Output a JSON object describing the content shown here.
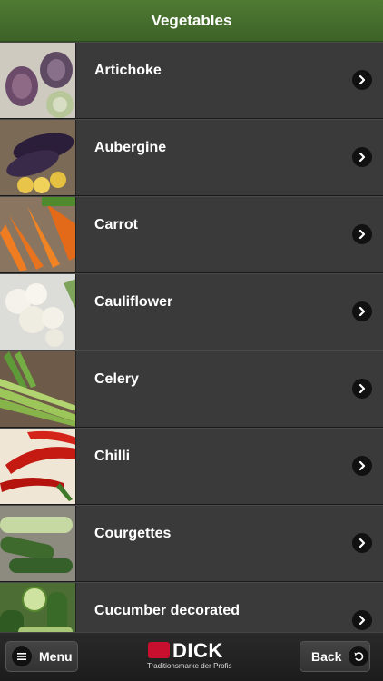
{
  "header": {
    "title": "Vegetables"
  },
  "items": [
    {
      "label": "Artichoke",
      "icon": "chevron-right-icon"
    },
    {
      "label": "Aubergine",
      "icon": "chevron-right-icon"
    },
    {
      "label": "Carrot",
      "icon": "chevron-right-icon"
    },
    {
      "label": "Cauliflower",
      "icon": "chevron-right-icon"
    },
    {
      "label": "Celery",
      "icon": "chevron-right-icon"
    },
    {
      "label": "Chilli",
      "icon": "chevron-right-icon"
    },
    {
      "label": "Courgettes",
      "icon": "chevron-right-icon"
    },
    {
      "label": "Cucumber decorated",
      "icon": "chevron-right-icon"
    }
  ],
  "footer": {
    "menu_label": "Menu",
    "menu_icon": "hamburger-icon",
    "back_label": "Back",
    "back_icon": "undo-arrow-icon",
    "logo_word": "DICK",
    "logo_tagline": "Traditionsmarke der Profis"
  },
  "colors": {
    "header_green": "#4f7a33",
    "row_bg": "#3a3a3a",
    "logo_red": "#c8102e"
  }
}
